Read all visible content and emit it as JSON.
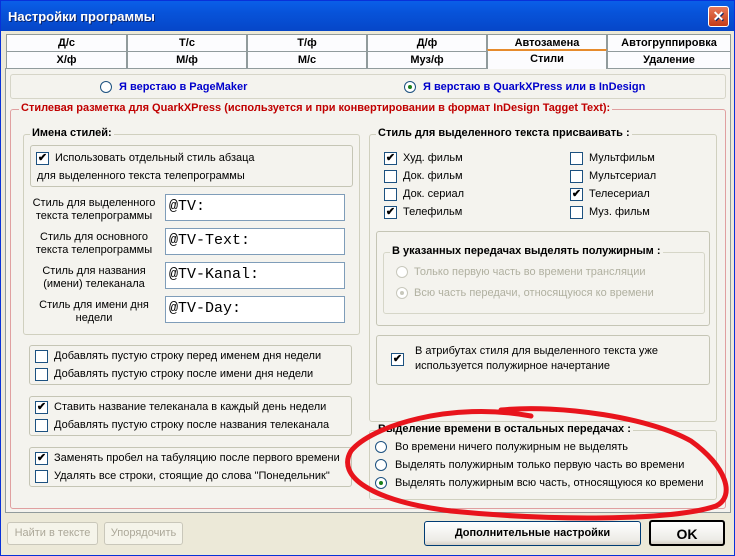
{
  "window": {
    "title": "Настройки программы",
    "close_glyph": "✕"
  },
  "tabs_row1": [
    "Д/с",
    "Т/с",
    "Т/ф",
    "Д/ф",
    "Автозамена",
    "Автогруппировка"
  ],
  "tabs_row2": [
    "Х/ф",
    "М/ф",
    "М/с",
    "Муз/ф",
    "Стили",
    "Удаление"
  ],
  "layout_mode": {
    "pagemaker": "Я верстаю в PageMaker",
    "quark": "Я верстаю в QuarkXPress или в InDesign",
    "selected": "quark"
  },
  "quark_group": {
    "title": "Стилевая разметка для QuarkXPress  (используется и при конвертировании в формат InDesign Tagget Text):"
  },
  "style_names": {
    "title": "Имена стилей:",
    "separate_style_line1": "Использовать отдельный стиль абзаца",
    "separate_style_line2": "для выделенного текста телепрограммы",
    "separate_style_checked": true,
    "fields": [
      {
        "label": "Стиль для выделенного текста телепрограммы",
        "value": "@TV:"
      },
      {
        "label": "Стиль для основного текста телепрограммы",
        "value": "@TV-Text:"
      },
      {
        "label": "Стиль для названия (имени) телеканала",
        "value": "@TV-Kanal:"
      },
      {
        "label": "Стиль  для имени дня недели",
        "value": "@TV-Day:"
      }
    ]
  },
  "day_options": [
    {
      "label": "Добавлять пустую строку перед именем дня недели",
      "checked": false
    },
    {
      "label": "Добавлять пустую строку после имени дня недели",
      "checked": false
    }
  ],
  "channel_options": [
    {
      "label": "Ставить название телеканала в каждый день недели",
      "checked": true
    },
    {
      "label": "Добавлять пустую строку после названия телеканала",
      "checked": false
    }
  ],
  "misc_options": [
    {
      "label": "Заменять пробел на табуляцию после первого времени",
      "checked": true
    },
    {
      "label": "Удалять все строки,  стоящие  до  слова  \"Понедельник\"",
      "checked": false
    }
  ],
  "assign_style": {
    "title": "Стиль для выделенного текста присваивать :",
    "items": [
      {
        "label": "Худ. фильм",
        "checked": true
      },
      {
        "label": "Мультфильм",
        "checked": false
      },
      {
        "label": "Док. фильм",
        "checked": false
      },
      {
        "label": "Мультсериал",
        "checked": false
      },
      {
        "label": "Док. сериал",
        "checked": false
      },
      {
        "label": "Телесериал",
        "checked": true
      },
      {
        "label": "Телефильм",
        "checked": true
      },
      {
        "label": "Муз. фильм",
        "checked": false
      }
    ]
  },
  "bold_in_selected": {
    "title": "В указанных передачах выделять полужирным :",
    "options": [
      "Только первую часть во времени трансляции",
      "Всю часть передачи, относящуюся ко времени"
    ],
    "selected": 1
  },
  "attr_note": {
    "line1": "В атрибутах стиля для выделенного текста уже",
    "line2": "используется полужирное начертание",
    "checked": true
  },
  "time_highlight": {
    "title": "Выделение времени в остальных передачах :",
    "options": [
      "Во времени ничего полужирным не выделять",
      "Выделять полужирным только первую часть во времени",
      "Выделять полужирным всю часть, относящуюся ко времени"
    ],
    "selected": 2
  },
  "buttons": {
    "find": "Найти в тексте",
    "sort": "Упорядочить",
    "more": "Дополнительные настройки",
    "ok": "OK"
  },
  "colors": {
    "accent_red": "#e8141c",
    "title_red": "#c00000",
    "blue_text": "#0000cc"
  }
}
